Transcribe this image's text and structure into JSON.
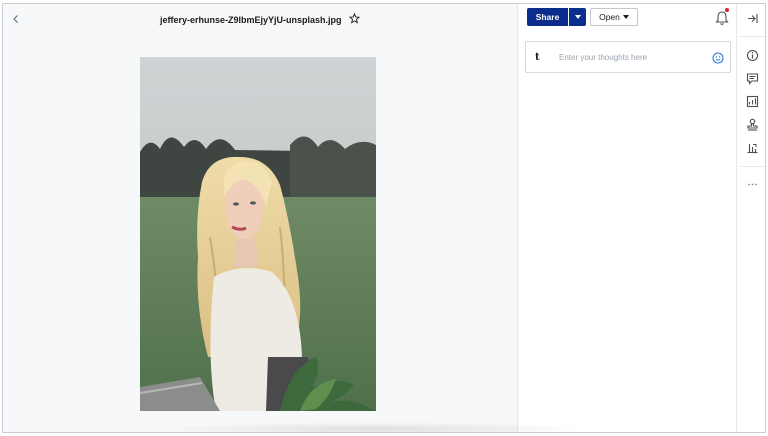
{
  "header": {
    "back_icon": "chevron-left-icon",
    "file_name": "jeffery-erhunse-Z9lbmEjyYjU-unsplash.jpg",
    "star_icon": "star-outline-icon"
  },
  "panel": {
    "share_label": "Share",
    "share_menu_icon": "caret-down-icon",
    "open_label": "Open",
    "notification_icon": "bell-icon",
    "notification_dot_color": "#e0252a",
    "comment_avatar": "t",
    "comment_placeholder": "Enter your thoughts here",
    "emoji_icon": "smiley-icon"
  },
  "rail": {
    "icons": [
      "collapse-panel-icon",
      "info-icon",
      "comment-icon",
      "activity-chart-icon",
      "stamp-icon",
      "analytics-icon",
      "more-icon"
    ]
  },
  "colors": {
    "brand": "#0b2d8c",
    "preview_bg": "#f7f8fa"
  }
}
